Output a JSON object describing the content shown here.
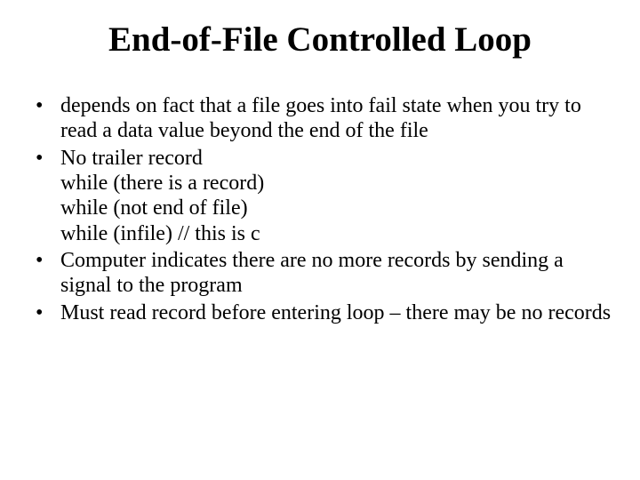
{
  "title": "End-of-File Controlled Loop",
  "bullets": [
    {
      "lines": [
        "depends on fact that a file goes into fail state when you try to read a data value beyond the end of the file"
      ]
    },
    {
      "lines": [
        "No trailer record",
        "while (there is a record)",
        "while (not end of file)",
        "while (infile)  // this is c"
      ]
    },
    {
      "lines": [
        "Computer indicates there are no more records by sending a signal to the program"
      ]
    },
    {
      "lines": [
        "Must read record before entering loop – there may be no records"
      ]
    }
  ]
}
